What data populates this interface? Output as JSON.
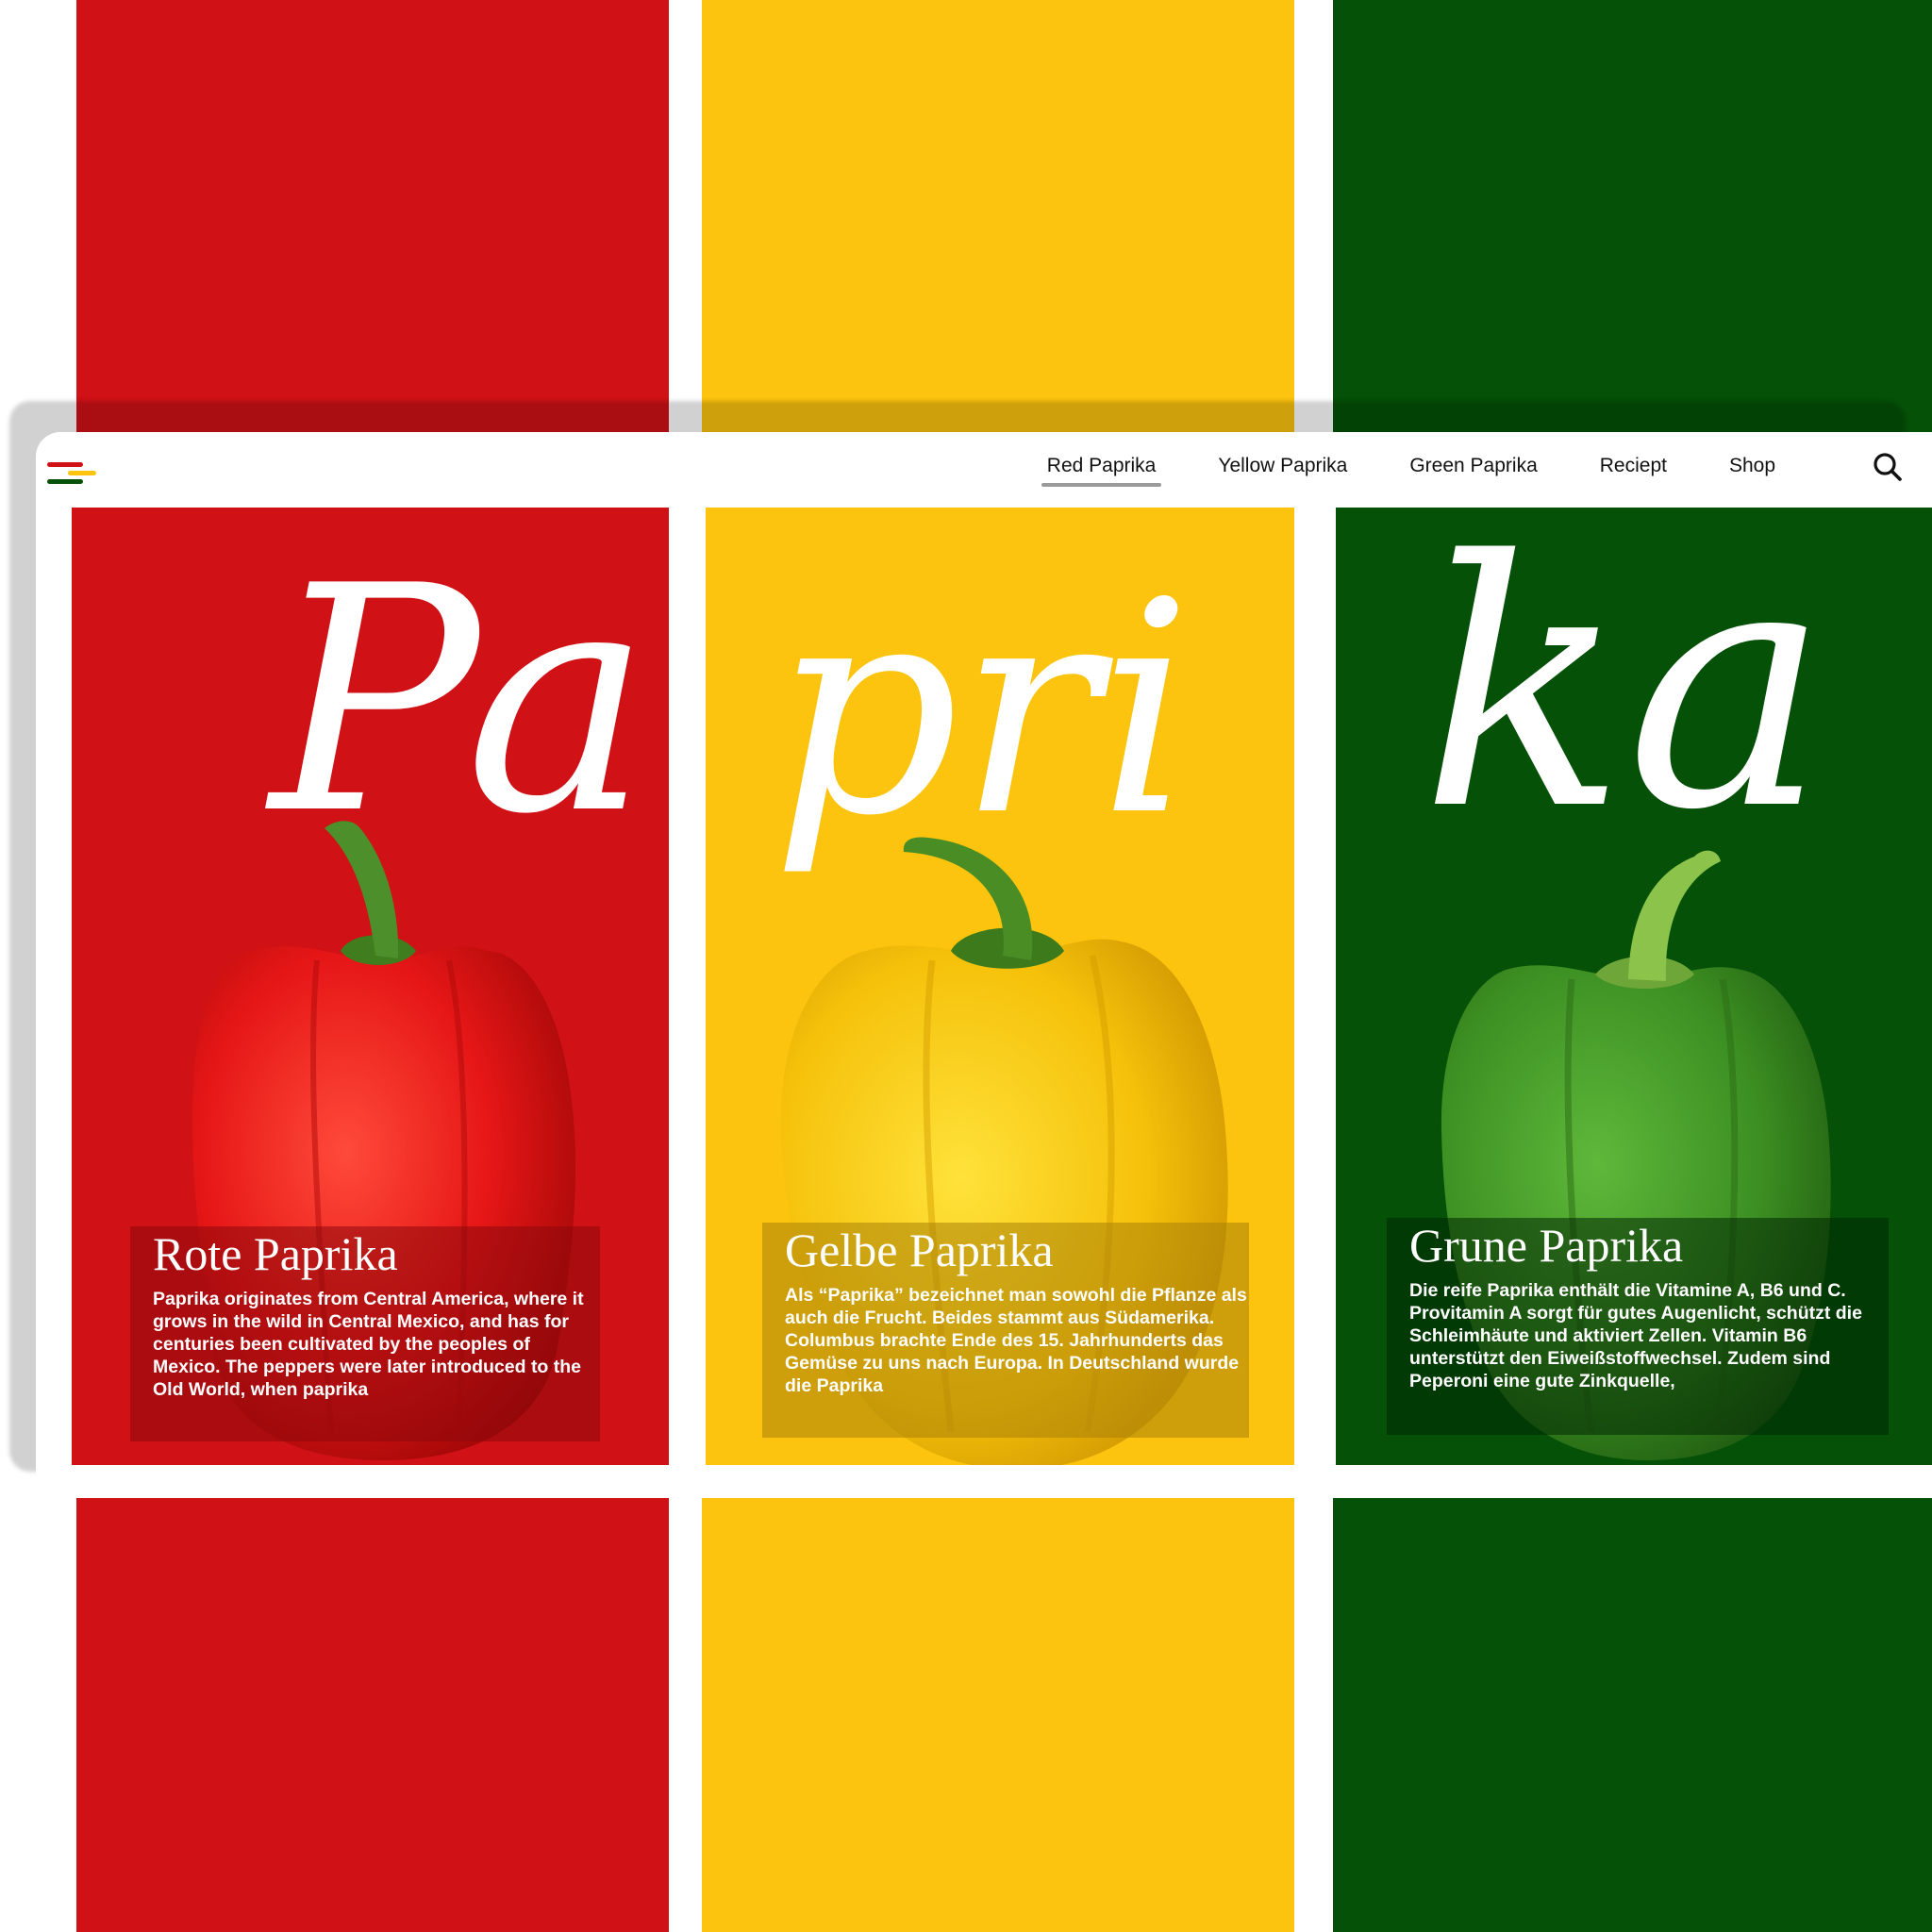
{
  "colors": {
    "red": "#d01116",
    "yellow": "#fcc40e",
    "green": "#045107",
    "nav_underline": "#9a9a9a"
  },
  "nav": {
    "logo_icon": "tricolor-menu-icon",
    "items": [
      {
        "label": "Red Paprika",
        "active": true
      },
      {
        "label": "Yellow Paprika",
        "active": false
      },
      {
        "label": "Green Paprika",
        "active": false
      },
      {
        "label": "Reciept",
        "active": false
      },
      {
        "label": "Shop",
        "active": false
      }
    ],
    "search_icon": "search-icon"
  },
  "panels": [
    {
      "letters": "Pa",
      "title": "Rote Paprika",
      "text": "Paprika originates from Central America, where it grows in the wild in Central Mexico, and has for centuries been cultivated by the peoples of Mexico. The peppers were later introduced to the Old World, when paprika"
    },
    {
      "letters": "pri",
      "title": "Gelbe Paprika",
      "text": "Als “Paprika” bezeichnet man sowohl die Pflanze als auch die Frucht. Beides stammt aus Südamerika. Columbus brachte Ende des 15. Jahrhunderts das Gemüse zu uns nach Europa. In Deutschland wurde die Paprika"
    },
    {
      "letters": "ka",
      "title": "Grune Paprika",
      "text": "Die reife Paprika enthält die Vitamine A, B6 und C. Provitamin A sorgt für gutes Augenlicht, schützt die Schleimhäute und aktiviert Zellen. Vitamin B6 unterstützt den Eiweißstoffwechsel. Zudem sind Peperoni eine gute Zinkquelle,"
    }
  ]
}
